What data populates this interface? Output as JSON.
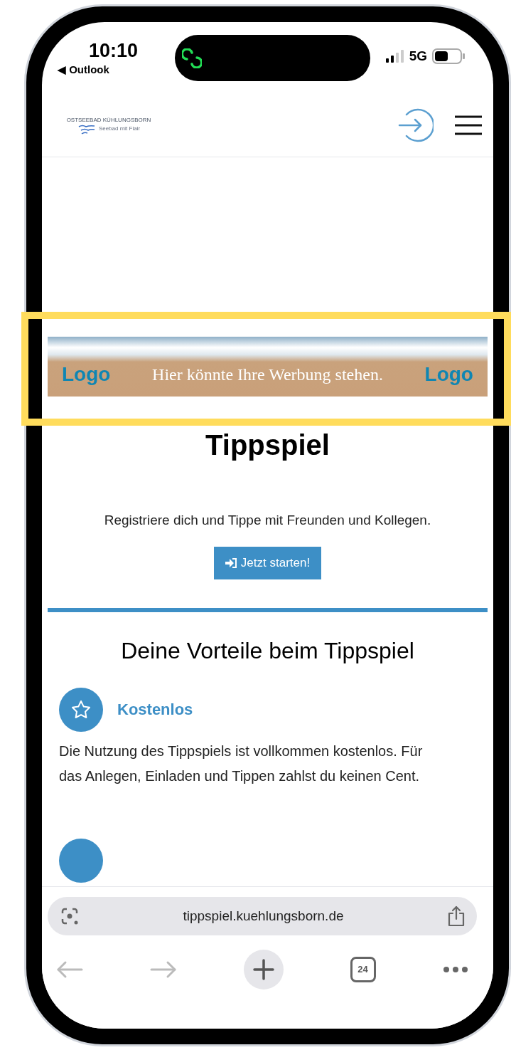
{
  "status_bar": {
    "time": "10:10",
    "back_app": "◀ Outlook",
    "network": "5G"
  },
  "header": {
    "logo_title": "OSTSEEBAD KÜHLUNGSBORN",
    "logo_subtitle": "Seebad mit Flair"
  },
  "banner": {
    "left_logo": "Logo",
    "text": "Hier könnte Ihre Werbung stehen.",
    "right_logo": "Logo"
  },
  "hero": {
    "title": "Tippspiel",
    "description": "Registriere dich und Tippe mit Freunden und Kollegen.",
    "button": "Jetzt starten!"
  },
  "benefits": {
    "title": "Deine Vorteile beim Tippspiel",
    "items": [
      {
        "title": "Kostenlos",
        "description": "Die Nutzung des Tippspiels ist vollkommen kostenlos. Für das Anlegen, Einladen und Tippen zahlst du keinen Cent."
      }
    ]
  },
  "browser": {
    "url": "tippspiel.kuehlungsborn.de",
    "tab_count": "24"
  }
}
